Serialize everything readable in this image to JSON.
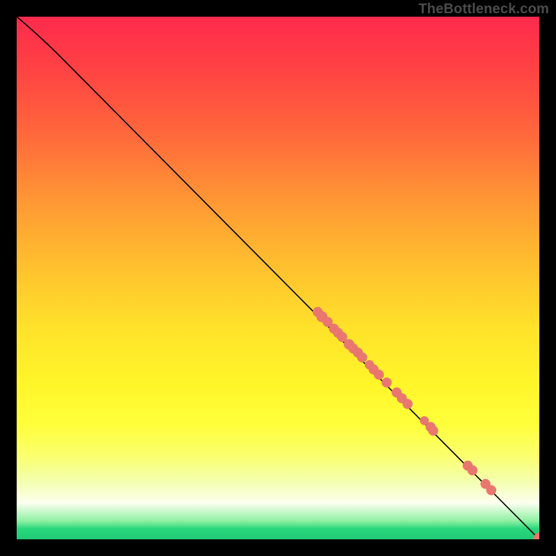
{
  "attribution": "TheBottleneck.com",
  "colors": {
    "curve": "#000000",
    "point": "#e9776f",
    "point_stroke": "#e67068"
  },
  "chart_data": {
    "type": "line",
    "title": "",
    "xlabel": "",
    "ylabel": "",
    "xlim": [
      0,
      100
    ],
    "ylim": [
      0,
      100
    ],
    "curve": [
      {
        "x": 0.0,
        "y": 100.0
      },
      {
        "x": 3.0,
        "y": 97.5
      },
      {
        "x": 6.0,
        "y": 94.8
      },
      {
        "x": 10.0,
        "y": 90.7
      },
      {
        "x": 100.0,
        "y": 0.0
      }
    ],
    "series": [
      {
        "name": "points",
        "values": [
          {
            "x": 57.6,
            "y": 43.5,
            "r": 1.7
          },
          {
            "x": 58.4,
            "y": 42.6,
            "r": 1.9
          },
          {
            "x": 59.5,
            "y": 41.6,
            "r": 1.7
          },
          {
            "x": 60.7,
            "y": 40.3,
            "r": 1.7
          },
          {
            "x": 61.5,
            "y": 39.5,
            "r": 1.7
          },
          {
            "x": 62.3,
            "y": 38.7,
            "r": 1.7
          },
          {
            "x": 63.6,
            "y": 37.3,
            "r": 1.8
          },
          {
            "x": 64.4,
            "y": 36.5,
            "r": 1.7
          },
          {
            "x": 65.3,
            "y": 35.7,
            "r": 1.7
          },
          {
            "x": 66.1,
            "y": 34.8,
            "r": 1.7
          },
          {
            "x": 67.5,
            "y": 33.4,
            "r": 1.6
          },
          {
            "x": 68.3,
            "y": 32.5,
            "r": 1.7
          },
          {
            "x": 69.3,
            "y": 31.5,
            "r": 1.7
          },
          {
            "x": 70.8,
            "y": 30.0,
            "r": 1.7
          },
          {
            "x": 72.7,
            "y": 28.1,
            "r": 1.7
          },
          {
            "x": 73.7,
            "y": 27.0,
            "r": 1.7
          },
          {
            "x": 74.8,
            "y": 25.9,
            "r": 1.7
          },
          {
            "x": 78.0,
            "y": 22.7,
            "r": 1.5
          },
          {
            "x": 79.2,
            "y": 21.5,
            "r": 1.7
          },
          {
            "x": 79.7,
            "y": 20.8,
            "r": 1.7
          },
          {
            "x": 86.3,
            "y": 14.1,
            "r": 1.7
          },
          {
            "x": 87.2,
            "y": 13.2,
            "r": 1.7
          },
          {
            "x": 89.7,
            "y": 10.6,
            "r": 1.7
          },
          {
            "x": 90.8,
            "y": 9.4,
            "r": 1.7
          },
          {
            "x": 100.1,
            "y": 0.1,
            "r": 2.2
          }
        ]
      }
    ]
  }
}
